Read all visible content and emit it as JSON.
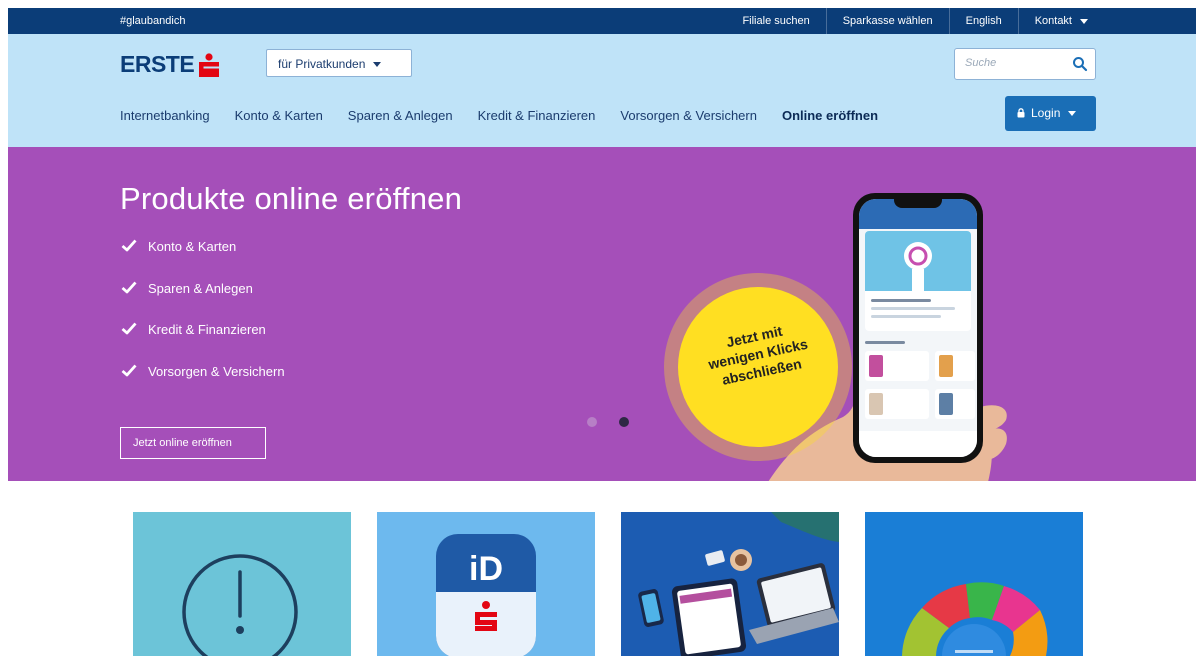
{
  "topbar": {
    "hashtag": "#glaubandich",
    "links": [
      "Filiale suchen",
      "Sparkasse wählen",
      "English",
      "Kontakt"
    ]
  },
  "header": {
    "logo_text": "ERSTE",
    "segment_label": "für Privatkunden",
    "search_placeholder": "Suche",
    "nav": [
      "Internetbanking",
      "Konto & Karten",
      "Sparen & Anlegen",
      "Kredit & Finanzieren",
      "Vorsorgen & Versichern",
      "Online eröffnen"
    ],
    "active_nav": "Online eröffnen",
    "login_label": "Login"
  },
  "hero": {
    "title": "Produkte online eröffnen",
    "checklist": [
      "Konto & Karten",
      "Sparen & Anlegen",
      "Kredit & Finanzieren",
      "Vorsorgen & Versichern"
    ],
    "cta_label": "Jetzt online eröffnen",
    "badge_lines": [
      "Jetzt mit",
      "wenigen Klicks",
      "abschließen"
    ],
    "carousel_active_index": 1
  },
  "cards": [
    {
      "icon": "exclamation-icon",
      "color": "#6cc4d8"
    },
    {
      "icon": "id-app-icon",
      "color": "#6db9ee",
      "icon_text": "iD"
    },
    {
      "icon": "devices-illustration",
      "color": "#1c5cb2"
    },
    {
      "icon": "donut-chart-illustration",
      "color": "#1a7ed6"
    }
  ],
  "colors": {
    "topbar": "#0b3d78",
    "header": "#bfe3f8",
    "hero": "#a54fb9",
    "accent_red": "#e30613",
    "badge": "#ffdf22",
    "login": "#1a6eb6"
  }
}
